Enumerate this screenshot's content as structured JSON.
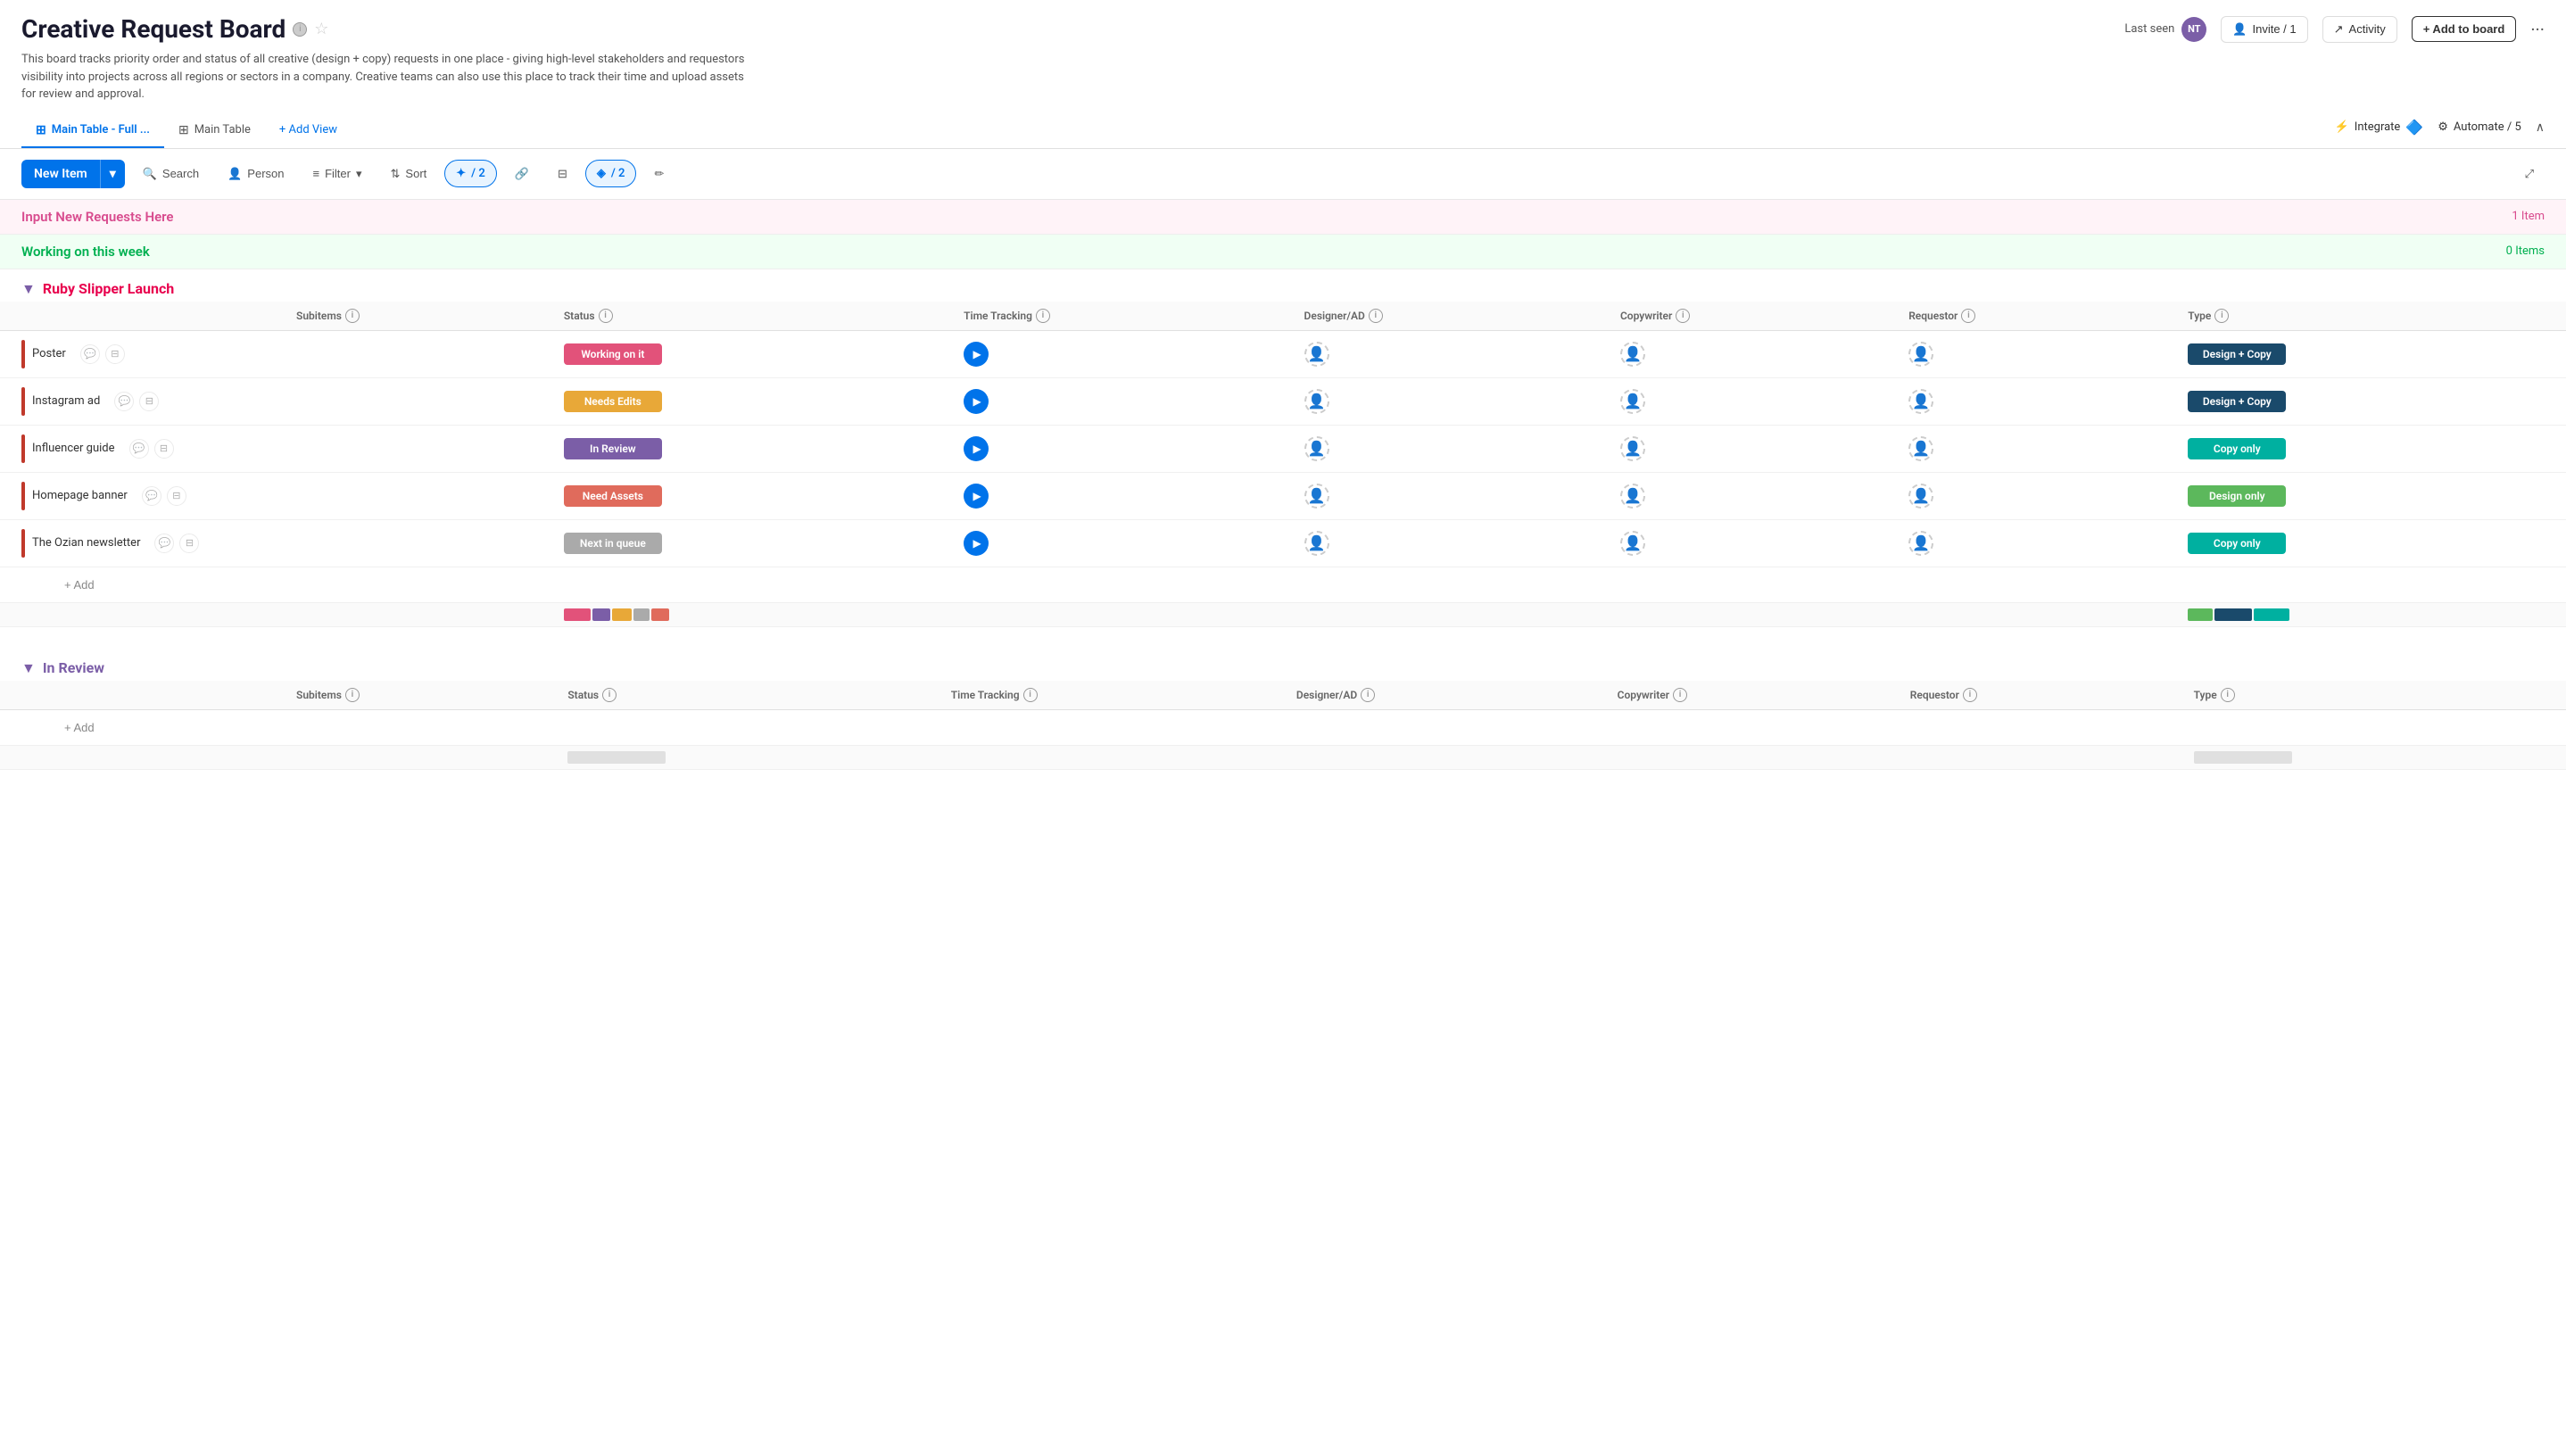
{
  "header": {
    "title": "Creative Request Board",
    "description": "This board tracks priority order and status of all creative (design + copy) requests in one place - giving high-level stakeholders and requestors visibility into projects across all regions or sectors in a company. Creative teams can also use this place to track their time and upload assets for review and approval.",
    "last_seen_label": "Last seen",
    "avatar_initials": "NT",
    "invite_label": "Invite / 1",
    "activity_label": "Activity",
    "add_to_board_label": "+ Add to board",
    "more_icon": "···"
  },
  "tabs": [
    {
      "id": "main-table-full",
      "label": "Main Table - Full ...",
      "icon": "⊞",
      "active": true
    },
    {
      "id": "main-table",
      "label": "Main Table",
      "icon": "⊞",
      "active": false
    }
  ],
  "add_view_label": "+ Add View",
  "integrate_label": "Integrate",
  "automate_label": "Automate / 5",
  "toolbar": {
    "new_item": "New Item",
    "search": "Search",
    "person": "Person",
    "filter": "Filter",
    "sort": "Sort",
    "group_by_badge": "/ 2",
    "columns_badge": "/ 2"
  },
  "sections": [
    {
      "id": "input-new-requests",
      "label": "Input New Requests Here",
      "count": "1 Item",
      "color": "#d84b8e",
      "count_color": "#d84b8e"
    },
    {
      "id": "working-this-week",
      "label": "Working on this week",
      "count": "0 Items",
      "color": "#00b050",
      "count_color": "#00b050"
    }
  ],
  "groups": [
    {
      "id": "ruby-slipper",
      "name": "Ruby Slipper Launch",
      "color": "#e8004d",
      "left_bar_color": "#c0392b",
      "columns": [
        "Subitems",
        "Status",
        "Time Tracking",
        "Designer/AD",
        "Copywriter",
        "Requestor",
        "Type"
      ],
      "items": [
        {
          "name": "Poster",
          "status": "Working on it",
          "status_color": "#e2527a",
          "time_tracking": true,
          "designer": "",
          "copywriter": "",
          "requestor": "",
          "type": "Design + Copy",
          "type_color": "#1a4a6b"
        },
        {
          "name": "Instagram ad",
          "status": "Needs Edits",
          "status_color": "#e8a838",
          "time_tracking": true,
          "designer": "",
          "copywriter": "",
          "requestor": "",
          "type": "Design + Copy",
          "type_color": "#1a4a6b"
        },
        {
          "name": "Influencer guide",
          "status": "In Review",
          "status_color": "#7b5ea7",
          "time_tracking": true,
          "designer": "",
          "copywriter": "",
          "requestor": "",
          "type": "Copy only",
          "type_color": "#00b0a0"
        },
        {
          "name": "Homepage banner",
          "status": "Need Assets",
          "status_color": "#e06b5c",
          "time_tracking": true,
          "designer": "",
          "copywriter": "",
          "requestor": "",
          "type": "Design only",
          "type_color": "#5cb85c"
        },
        {
          "name": "The Ozian newsletter",
          "status": "Next in queue",
          "status_color": "#aaaaaa",
          "time_tracking": true,
          "designer": "",
          "copywriter": "",
          "requestor": "",
          "type": "Copy only",
          "type_color": "#00b0a0"
        }
      ],
      "summary_status_bars": [
        {
          "color": "#e2527a",
          "width": 30
        },
        {
          "color": "#7b5ea7",
          "width": 20
        },
        {
          "color": "#e8a838",
          "width": 22
        },
        {
          "color": "#aaaaaa",
          "width": 18
        },
        {
          "color": "#e06b5c",
          "width": 20
        }
      ],
      "summary_type_bars": [
        {
          "color": "#5cb85c",
          "width": 28
        },
        {
          "color": "#1a4a6b",
          "width": 42
        },
        {
          "color": "#00b0a0",
          "width": 40
        }
      ]
    }
  ],
  "in_review_group": {
    "name": "In Review",
    "color": "#7b5ea7",
    "columns": [
      "Subitems",
      "Status",
      "Time Tracking",
      "Designer/AD",
      "Copywriter",
      "Requestor",
      "Type"
    ],
    "items": []
  },
  "add_label": "+ Add",
  "copy_only_label": "Copy only",
  "design_only_label": "Design only"
}
